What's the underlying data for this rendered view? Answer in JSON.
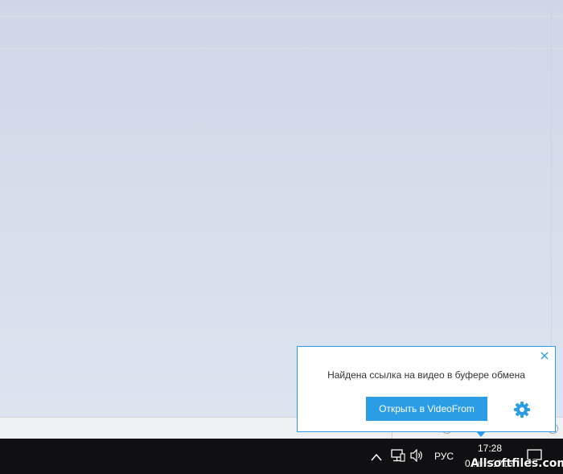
{
  "popup": {
    "message": "Найдена ссылка на видео в буфере обмена",
    "open_button_label": "Открыть в VideoFrom",
    "close_icon": "close-icon",
    "settings_icon": "gear-icon",
    "accent_color": "#2b9de6"
  },
  "taskbar": {
    "language": "РУС",
    "time": "17:28",
    "date": "04.07.2018",
    "tray_icons": [
      "chevron-up-icon",
      "network-icon",
      "volume-icon",
      "action-center-icon"
    ]
  },
  "watermark": {
    "text": "Allsoftfiles.com"
  }
}
